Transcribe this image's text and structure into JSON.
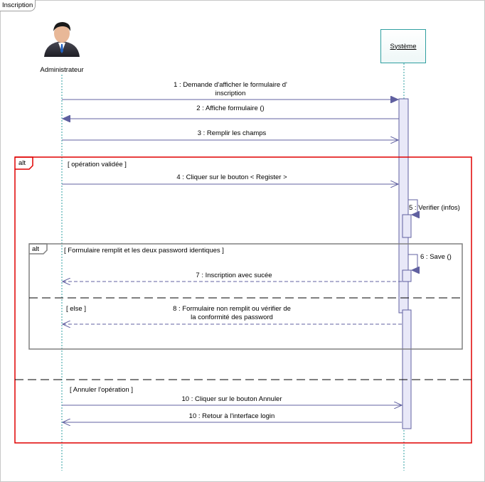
{
  "frame": {
    "title": "Inscription"
  },
  "actors": {
    "admin": {
      "label": "Administrateur",
      "icon": "person-icon"
    },
    "system": {
      "label": "Système"
    }
  },
  "messages": {
    "m1_line1": "1 : Demande d'afficher le formulaire d'",
    "m1_line2": "inscription",
    "m2": "2 : Affiche formulaire ()",
    "m3": "3 : Remplir les champs",
    "m4": "4 : Cliquer sur le bouton < Register >",
    "m5": "5 : Verifier (infos)",
    "m6": "6 : Save ()",
    "m7": "7 : Inscription avec sucée",
    "m8_line1": "8 : Formulaire non remplit ou vérifier de",
    "m8_line2": "la conformité des password",
    "m10a": "10 : Cliquer sur le bouton Annuler",
    "m10b": "10 : Retour à l'interface login"
  },
  "fragments": {
    "outer": {
      "operator": "alt",
      "guard1": "[ opération validée ]",
      "guard2": "[ Annuler l'opération ]"
    },
    "inner": {
      "operator": "alt",
      "guard1": "[ Formulaire remplit et les deux password identiques ]",
      "guard2": "[ else ]"
    }
  },
  "colors": {
    "outer_frame": "#e00000",
    "inner_frame": "#808080",
    "message": "#6060a0",
    "lifeline": "#2f9fa0",
    "activation": "#e8e8f8"
  }
}
